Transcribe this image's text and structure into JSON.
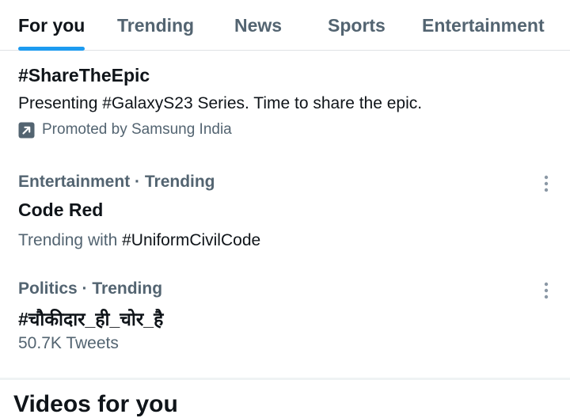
{
  "tabs": [
    {
      "label": "For you",
      "active": true
    },
    {
      "label": "Trending",
      "active": false
    },
    {
      "label": "News",
      "active": false
    },
    {
      "label": "Sports",
      "active": false
    },
    {
      "label": "Entertainment",
      "active": false
    }
  ],
  "promoted": {
    "title": "#ShareTheEpic",
    "description": "Presenting #GalaxyS23 Series. Time to share the epic.",
    "promoted_by": "Promoted by Samsung India",
    "icon": "promoted-arrow-icon"
  },
  "trends": [
    {
      "category": "Entertainment · Trending",
      "title": "Code Red",
      "subtitle_prefix": "Trending with ",
      "subtitle_link": "#UniformCivilCode"
    },
    {
      "category": "Politics · Trending",
      "title": "#चौकीदार_ही_चोर_है",
      "count": "50.7K Tweets"
    }
  ],
  "next_section": {
    "title": "Videos for you"
  },
  "colors": {
    "accent": "#1d9bf0",
    "text_primary": "#0f1419",
    "text_secondary": "#536471"
  }
}
